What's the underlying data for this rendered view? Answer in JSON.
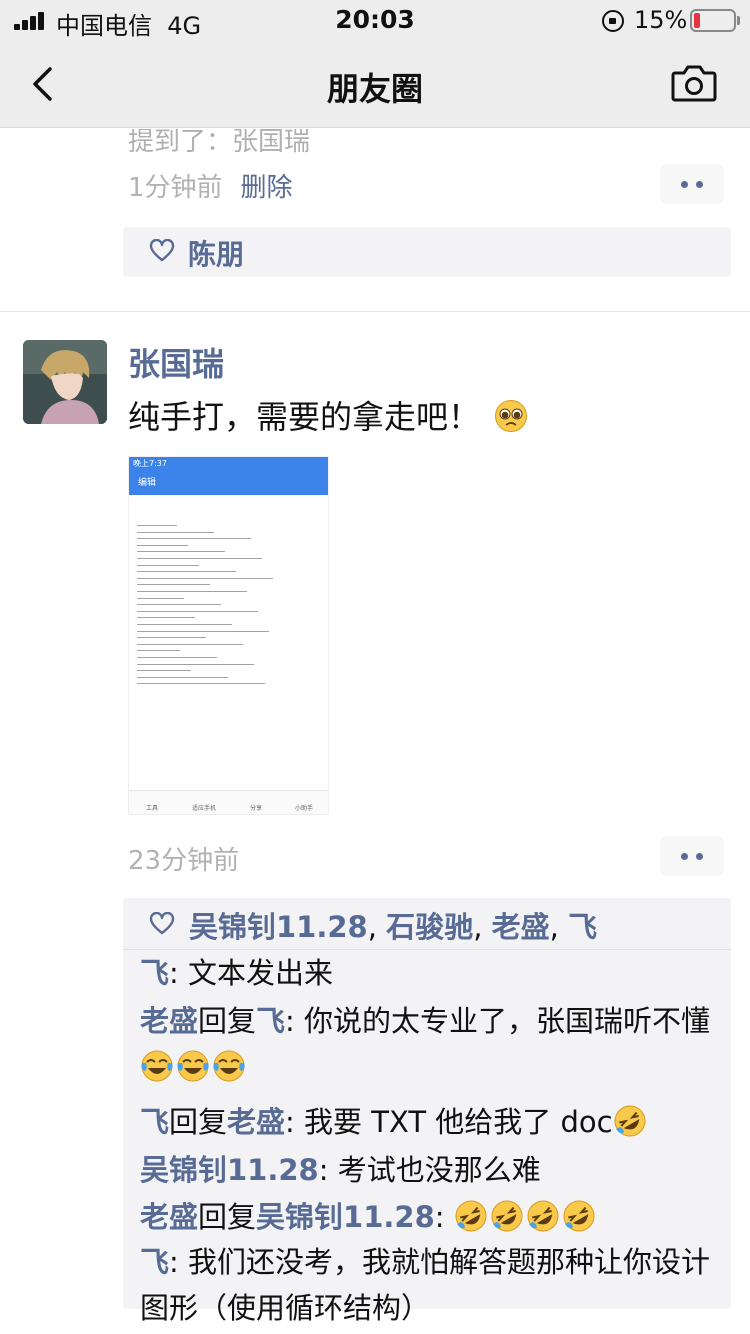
{
  "status_bar": {
    "carrier": "中国电信",
    "network": "4G",
    "time": "20:03",
    "battery_percent": "15%",
    "battery_level": 0.15
  },
  "nav": {
    "title": "朋友圈",
    "back_icon": "chevron-left-icon",
    "camera_icon": "camera-icon"
  },
  "previous_post": {
    "mention": "提到了：张国瑞",
    "time": "1分钟前",
    "delete_label": "删除",
    "likes": [
      "陈朋"
    ]
  },
  "post": {
    "author": "张国瑞",
    "text": "纯手打，需要的拿走吧！",
    "text_emoji": "pleading-face-emoji",
    "image_labels": {
      "status_time": "晚上7:37",
      "edit": "编辑",
      "bottom_tools": [
        "工具",
        "适应手机",
        "分享",
        "小助手"
      ]
    },
    "time": "23分钟前",
    "likes": [
      "吴锦钊11.28",
      "石骏驰",
      "老盛",
      "飞"
    ],
    "comments": [
      {
        "from": "飞",
        "to": "",
        "text": "文本发出来",
        "emoji_count": 0
      },
      {
        "from": "老盛",
        "to": "飞",
        "text": "你说的太专业了，张国瑞听不懂",
        "emoji_count": 3,
        "emoji": "tears-of-joy-emoji"
      },
      {
        "from": "飞",
        "to": "老盛",
        "text": "我要 TXT 他给我了 doc",
        "emoji_count": 1,
        "emoji": "rolling-laughing-emoji"
      },
      {
        "from": "吴锦钊11.28",
        "to": "",
        "text": "考试也没那么难",
        "emoji_count": 0
      },
      {
        "from": "老盛",
        "to": "吴锦钊11.28",
        "text": "",
        "emoji_count": 4,
        "emoji": "rolling-laughing-emoji"
      },
      {
        "from": "飞",
        "to": "",
        "text": "我们还没考，我就怕解答题那种让你设计图形（使用循环结构）",
        "emoji_count": 0
      }
    ],
    "reply_word": "回复",
    "colon": ": ",
    "comma": ", "
  },
  "colors": {
    "link": "#576b95",
    "bar_bg": "#ededed",
    "comment_bg": "#f3f3f5",
    "battery_low": "#e8323c"
  }
}
